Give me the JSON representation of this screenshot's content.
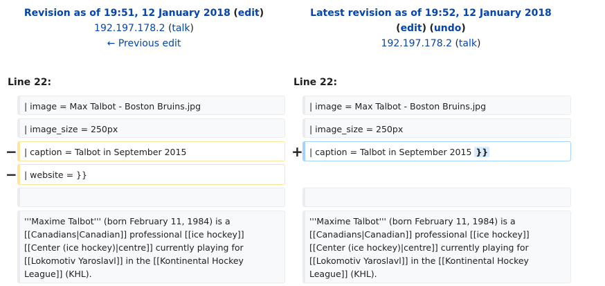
{
  "left_header": {
    "revision_label": "Revision as of 19:51, 12 January 2018",
    "edit_label": "edit",
    "user_label": "192.197.178.2",
    "talk_label": "talk",
    "previous_edit_label": "← Previous edit"
  },
  "right_header": {
    "revision_label": "Latest revision as of 19:52, 12 January 2018",
    "edit_label": "edit",
    "undo_label": "undo",
    "user_label": "192.197.178.2",
    "talk_label": "talk"
  },
  "line_numbers": {
    "left": "Line 22:",
    "right": "Line 22:"
  },
  "markers": {
    "removed": "−",
    "added": "+"
  },
  "rows": {
    "context1": "| image = Max Talbot - Boston Bruins.jpg",
    "context2": "| image_size = 250px",
    "deleted_caption": "| caption = Talbot in September 2015",
    "added_caption": "| caption = Talbot in September 2015",
    "added_insert": "}}",
    "deleted_website": "| website = }}",
    "paragraph": "'''Maxime Talbot''' (born February 11, 1984) is a [[Canadians|Canadian]] professional [[ice hockey]] [[Center (ice hockey)|centre]] currently playing for [[Lokomotiv Yaroslavl]] in the [[Kontinental Hockey League]] (KHL)."
  }
}
